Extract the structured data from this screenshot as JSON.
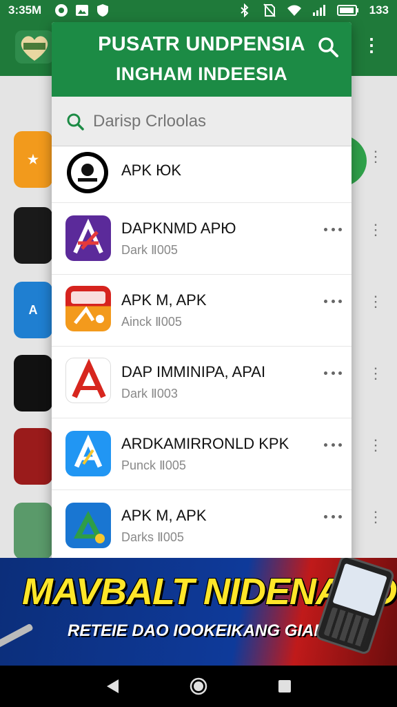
{
  "status_bar": {
    "time": "3:35M",
    "battery": "133"
  },
  "panel": {
    "title": "PUSATR UNDPENSIA",
    "subtitle": "INGHAM INDEESIA",
    "search": {
      "placeholder": "Darisp Crloolas"
    }
  },
  "apps": [
    {
      "name": "APK ЮK",
      "sub": ""
    },
    {
      "name": "DAPKNMD APЮ",
      "sub": "Dark  Ⅱ005"
    },
    {
      "name": "APK M, APK",
      "sub": "Ainck  Ⅱ005"
    },
    {
      "name": "DAP IMMINIPA, APAI",
      "sub": "Dark  Ⅱ003"
    },
    {
      "name": "ARDKAMIRRONLD KPK",
      "sub": "Punck  Ⅱ005"
    },
    {
      "name": "APK M, APK",
      "sub": "Darks  Ⅱ005"
    }
  ],
  "banner": {
    "headline": "MAVBALT NIDENANO",
    "subline": "RETEIE DAO IOOKEIKANG GIANBIN!"
  },
  "colors": {
    "brand_green": "#1c8b45",
    "banner_yellow": "#ffe629"
  },
  "icons": [
    "wifi-icon",
    "signal-icon",
    "search-icon",
    "more-horiz-icon",
    "back-icon",
    "home-icon",
    "recents-icon"
  ]
}
